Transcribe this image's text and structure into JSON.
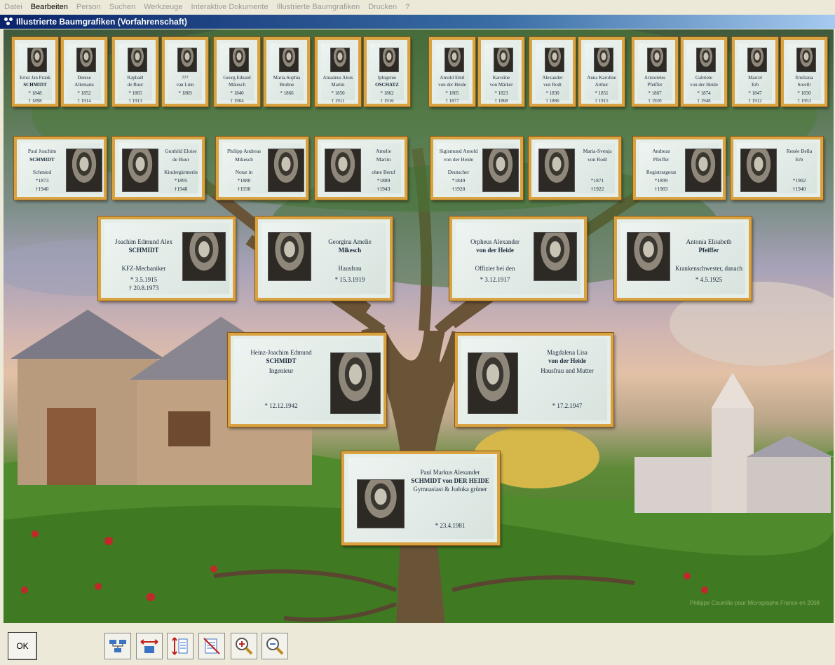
{
  "menu": [
    "Datei",
    "Bearbeiten",
    "Person",
    "Suchen",
    "Werkzeuge",
    "Interaktive Dokumente",
    "Illustrierte Baumgrafiken",
    "Drucken",
    "?"
  ],
  "window": {
    "title": "Illustrierte Baumgrafiken (Vorfahrenschaft)"
  },
  "watermark": "Philippe Coumilie pour Micrographe France en 2008",
  "toolbar": {
    "ok_label": "OK",
    "icons": [
      "layout-icon",
      "fit-width-icon",
      "fit-height-icon",
      "fit-page-icon",
      "zoom-in-icon",
      "zoom-out-icon"
    ]
  },
  "gen5": [
    {
      "l1": "Ernst Jan Frank",
      "l2": "SCHMIDT",
      "b": "* 1848",
      "d": "† 1898"
    },
    {
      "l1": "Denise",
      "l2": "Allemann",
      "b": "* 1852",
      "d": "† 1914"
    },
    {
      "l1": "Raphaël",
      "l2": "de Buur",
      "b": "* 1865",
      "d": "† 1913"
    },
    {
      "l1": "???",
      "l2": "van Linn",
      "b": "* 1869",
      "d": ""
    },
    {
      "l1": "Georg Eduard",
      "l2": "Mikesch",
      "b": "* 1840",
      "d": "† 1904"
    },
    {
      "l1": "Maria-Sophia",
      "l2": "Bruhne",
      "b": "* 1866",
      "d": ""
    },
    {
      "l1": "Amadeus Alois",
      "l2": "Martin",
      "b": "* 1850",
      "d": "† 1911"
    },
    {
      "l1": "Iphigenie",
      "l2": "OSCHATZ",
      "b": "* 1862",
      "d": "† 1916"
    },
    {
      "l1": "Arnold Emil",
      "l2": "von der Heide",
      "b": "* 1805",
      "d": "† 1877"
    },
    {
      "l1": "Karoline",
      "l2": "von Märker",
      "b": "* 1823",
      "d": "† 1868"
    },
    {
      "l1": "Alexander",
      "l2": "von Rodt",
      "b": "* 1830",
      "d": "† 1886"
    },
    {
      "l1": "Anna Karoline",
      "l2": "Arthur",
      "b": "* 1851",
      "d": "† 1915"
    },
    {
      "l1": "Aristoteles",
      "l2": "Pfeiffer",
      "b": "* 1867",
      "d": "† 1920"
    },
    {
      "l1": "Gabriele",
      "l2": "von der Heide",
      "b": "* 1874",
      "d": "† 1948"
    },
    {
      "l1": "Marcel",
      "l2": "Erb",
      "b": "* 1847",
      "d": "† 1912"
    },
    {
      "l1": "Emiliana",
      "l2": "Sorelli",
      "b": "* 1830",
      "d": "† 1953"
    }
  ],
  "gen4": [
    {
      "l1": "Paul Joachim",
      "l2": "SCHMIDT",
      "l3": "Schmied",
      "b": "*1873",
      "d": "†1940"
    },
    {
      "l1": "Gunhild Eloise",
      "l2": "de Buur",
      "l3": "Kindergärtnerin",
      "b": "*1895",
      "d": "†1948"
    },
    {
      "l1": "Philipp Andreas",
      "l2": "Mikesch",
      "l3": "Notar in",
      "b": "*1880",
      "d": "†1930"
    },
    {
      "l1": "Amelie",
      "l2": "Martin",
      "l3": "ohne Beruf",
      "b": "*1889",
      "d": "†1943"
    },
    {
      "l1": "Sigismund Arnold",
      "l2": "von der Heide",
      "l3": "Deutscher",
      "b": "*1849",
      "d": "†1920"
    },
    {
      "l1": "Maria-Svenja",
      "l2": "von Rodt",
      "l3": "",
      "b": "*1871",
      "d": "†1922"
    },
    {
      "l1": "Andreas",
      "l2": "Pfeiffer",
      "l3": "Registrargerat",
      "b": "*1899",
      "d": "†1983"
    },
    {
      "l1": "Renée Bella",
      "l2": "Erb",
      "l3": "",
      "b": "*1902",
      "d": "†1940"
    }
  ],
  "gen3": [
    {
      "l1": "Joachim Edmund Alex",
      "l2": "SCHMIDT",
      "l3": "KFZ-Mechaniker",
      "b": "* 3.5.1915",
      "d": "† 20.8.1973"
    },
    {
      "l1": "Georgina Amelie",
      "l2": "Mikesch",
      "l3": "Hausfrau",
      "b": "* 15.3.1919",
      "d": ""
    },
    {
      "l1": "Orpheus Alexander",
      "l2": "von der Heide",
      "l3": "Offizier bei den",
      "b": "* 3.12.1917",
      "d": ""
    },
    {
      "l1": "Antonia Elisabeth",
      "l2": "Pfeiffer",
      "l3": "Krankenschwester, danach",
      "b": "* 4.5.1925",
      "d": ""
    }
  ],
  "gen2": [
    {
      "l1": "Heinz-Joachim Edmund",
      "l2": "SCHMIDT",
      "l3": "Ingenieur",
      "b": "* 12.12.1942"
    },
    {
      "l1": "Magdalena Lisa",
      "l2": "von der Heide",
      "l3": "Hausfrau und Mutter",
      "b": "* 17.2.1947"
    }
  ],
  "gen1": {
    "l1": "Paul Markus Alexander",
    "l2": "SCHMIDT von DER HEIDE",
    "l3": "Gymnasiast & Judoka grüner",
    "b": "* 23.4.1981"
  }
}
